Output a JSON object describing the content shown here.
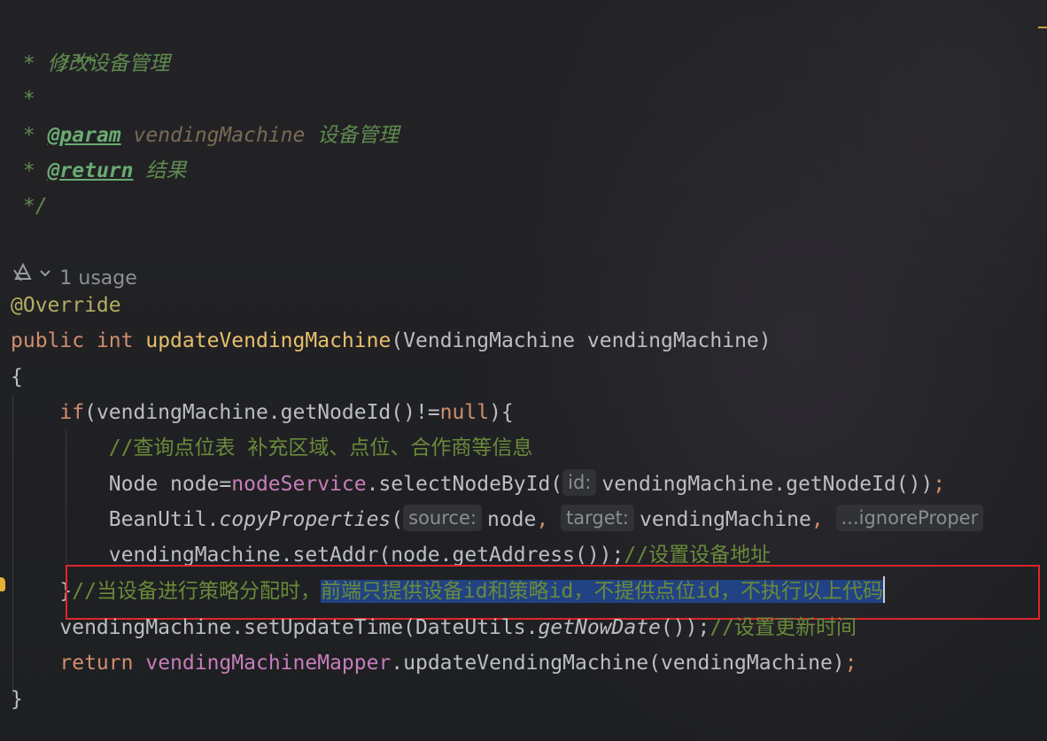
{
  "doc_comment": {
    "open": "/**",
    "star": " *",
    "summary": "修改设备管理",
    "param_tag": "@param",
    "param_name": "vendingMachine",
    "param_desc": "设备管理",
    "return_tag": "@return",
    "return_desc": "结果",
    "close": " */"
  },
  "usage_hint": "1 usage",
  "annotation": "@Override",
  "signature": {
    "modifier": "public",
    "return_type": "int",
    "method_name": "updateVendingMachine",
    "open": "(",
    "param_type": "VendingMachine",
    "param_name": "vendingMachine",
    "close": ")"
  },
  "brace_open": "{",
  "brace_close": "}",
  "if_line": {
    "keyword": "if",
    "condition": "(vendingMachine.getNodeId()!=",
    "null_kw": "null",
    "tail": "){"
  },
  "comment_lookup": "//查询点位表 补充区域、点位、合作商等信息",
  "node_line": {
    "decl": "Node node=",
    "field": "nodeService",
    "call": ".selectNodeById(",
    "hint": "id:",
    "arg": "vendingMachine.getNodeId())",
    "semicolon": ";"
  },
  "copy_line": {
    "class_name": "BeanUtil.",
    "method": "copyProperties",
    "open": "(",
    "hint_source": "source:",
    "arg_source": "node",
    "comma1": ",",
    "hint_target": "target:",
    "arg_target": "vendingMachine",
    "comma2": ",",
    "hint_ignore": "...ignoreProper"
  },
  "addr_line": {
    "code": "vendingMachine.setAddr(node.getAddress());",
    "comment": "//设置设备地址"
  },
  "brace_line": {
    "brace": "}",
    "comment_plain": "//当设备进行策略分配时，",
    "comment_selected": "前端只提供设备id和策略id，不提供点位id，不执行以上代码"
  },
  "update_time_line": {
    "code_start": "vendingMachine.setUpdateTime(DateUtils.",
    "method": "getNowDate",
    "code_end": "());",
    "comment": "//设置更新时间"
  },
  "return_line": {
    "keyword": "return",
    "field": "vendingMachineMapper",
    "call": ".updateVendingMachine(vendingMachine)",
    "semicolon": ";"
  },
  "colors": {
    "selection": "#214283",
    "highlight_box": "#e0252a",
    "keyword": "#cf8e6d",
    "method": "#e8bf6a",
    "comment": "#6a8a3a"
  }
}
